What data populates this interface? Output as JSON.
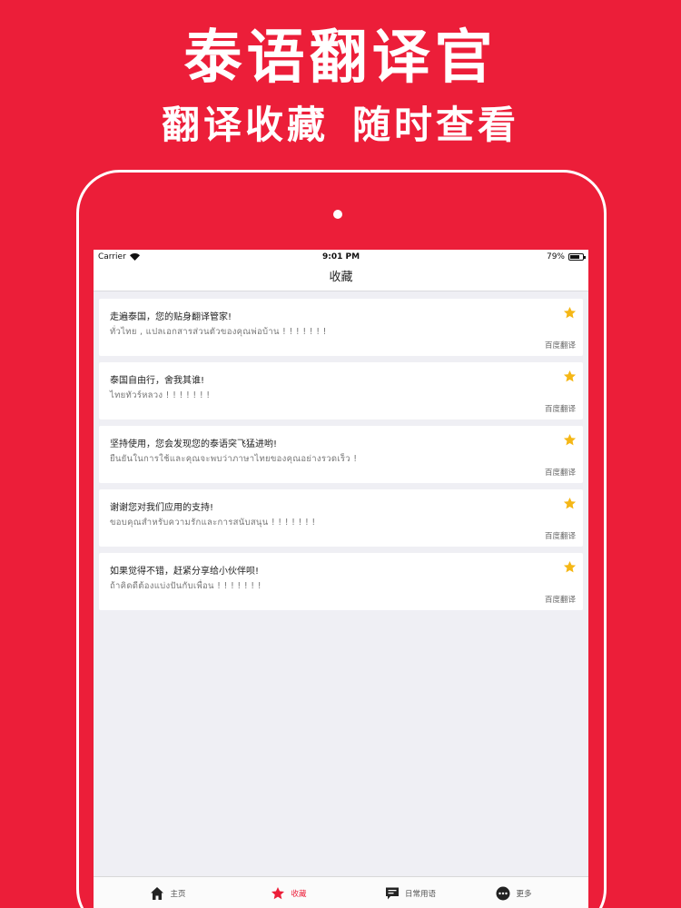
{
  "promo": {
    "title": "泰语翻译官",
    "subtitle_left": "翻译收藏",
    "subtitle_right": "随时查看"
  },
  "status_bar": {
    "carrier": "Carrier",
    "time": "9:01 PM",
    "battery": "79%",
    "battery_level": 0.79
  },
  "nav": {
    "title": "收藏"
  },
  "favorites": [
    {
      "source": "走遍泰国，您的贴身翻译管家!",
      "target": "ทั่วไทย , แปลเอกสารส่วนตัวของคุณพ่อบ้าน ! ! ! ! ! ! !",
      "engine": "百度翻译"
    },
    {
      "source": "泰国自由行，舍我其谁!",
      "target": "ไทยทัวร์หลวง ! ! ! ! ! ! !",
      "engine": "百度翻译"
    },
    {
      "source": "坚持使用，您会发现您的泰语突飞猛进哟!",
      "target": "ยืนยันในการใช้และคุณจะพบว่าภาษาไทยของคุณอย่างรวดเร็ว !",
      "engine": "百度翻译"
    },
    {
      "source": "谢谢您对我们应用的支持!",
      "target": "ขอบคุณสำหรับความรักและการสนับสนุน ! ! ! ! ! ! !",
      "engine": "百度翻译"
    },
    {
      "source": "如果觉得不错，赶紧分享给小伙伴呗!",
      "target": "ถ้าคิดดีต้องแบ่งปันกับเพื่อน ! ! ! ! ! ! !",
      "engine": "百度翻译"
    }
  ],
  "tabs": [
    {
      "label": "主页",
      "icon": "home-icon"
    },
    {
      "label": "收藏",
      "icon": "star-icon"
    },
    {
      "label": "日常用语",
      "icon": "chat-icon"
    },
    {
      "label": "更多",
      "icon": "more-icon"
    }
  ],
  "colors": {
    "brand_red": "#ec1e39",
    "star_gold": "#f5b716",
    "screen_bg": "#efeff4"
  }
}
